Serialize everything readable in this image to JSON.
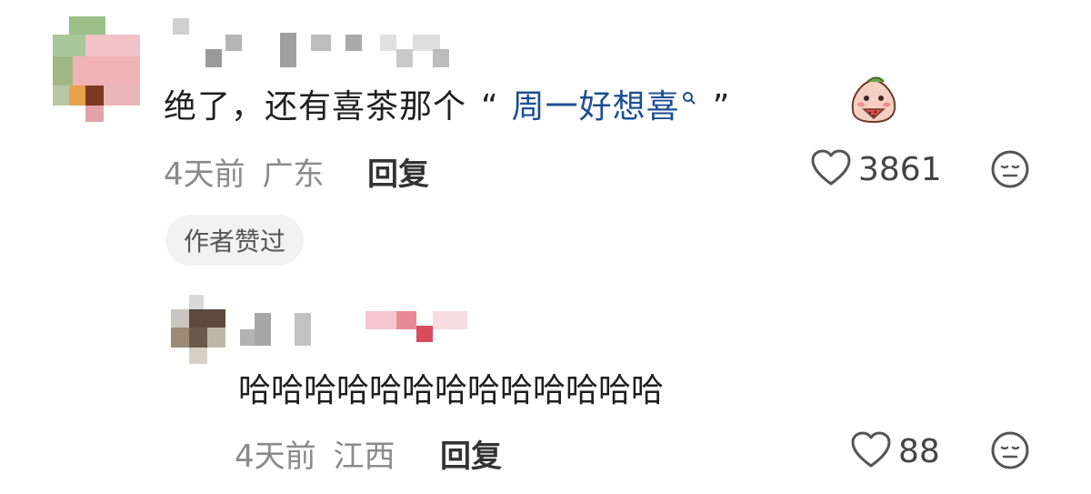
{
  "comment": {
    "text_main": "绝了，还有喜茶那个",
    "quote_open": "“",
    "link_text": "周一好想喜",
    "quote_close": "”",
    "date": "4天前",
    "location": "广东",
    "reply_label": "回复",
    "like_count": "3861",
    "author_liked": "作者赞过",
    "icons": {
      "like": "heart-outline-icon",
      "dislike": "neutral-face-icon",
      "sticker": "peach-sticker-icon",
      "link": "search-icon"
    }
  },
  "reply": {
    "text": "哈哈哈哈哈哈哈哈哈哈哈哈哈",
    "date": "4天前",
    "location": "江西",
    "reply_label": "回复",
    "like_count": "88"
  },
  "colors": {
    "link": "#1d4f91",
    "meta": "#8a8a8a",
    "badge_bg": "#f2f2f2"
  }
}
